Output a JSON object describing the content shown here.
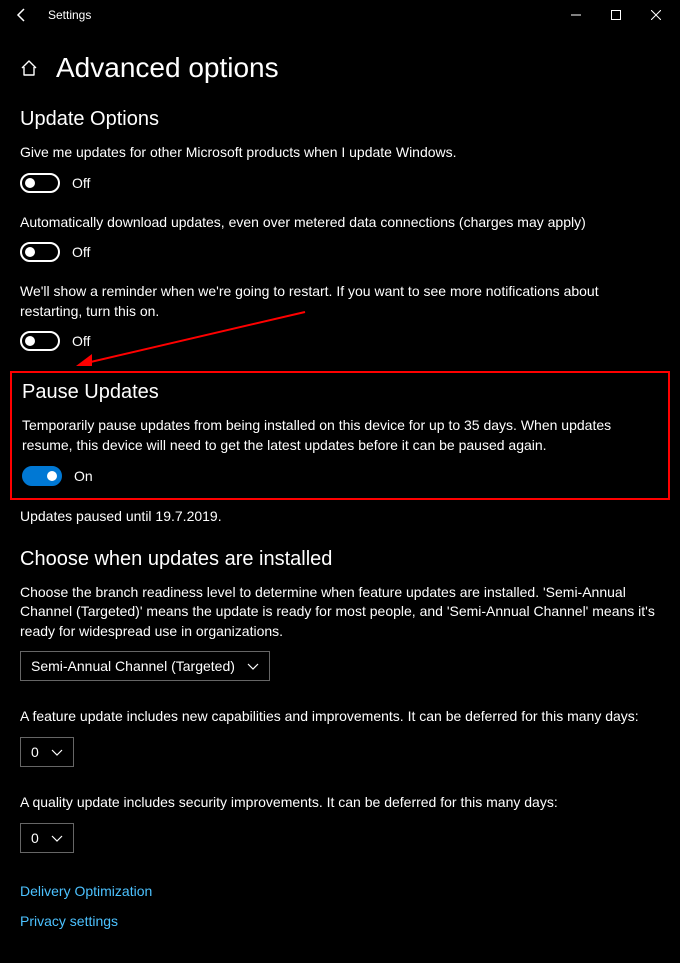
{
  "titlebar": {
    "app_title": "Settings"
  },
  "header": {
    "page_title": "Advanced options"
  },
  "update_options": {
    "heading": "Update Options",
    "item1": {
      "desc": "Give me updates for other Microsoft products when I update Windows.",
      "state": "Off"
    },
    "item2": {
      "desc": "Automatically download updates, even over metered data connections (charges may apply)",
      "state": "Off"
    },
    "item3": {
      "desc": "We'll show a reminder when we're going to restart. If you want to see more notifications about restarting, turn this on.",
      "state": "Off"
    }
  },
  "pause_updates": {
    "heading": "Pause Updates",
    "desc": "Temporarily pause updates from being installed on this device for up to 35 days. When updates resume, this device will need to get the latest updates before it can be paused again.",
    "state": "On",
    "status": "Updates paused until 19.7.2019."
  },
  "choose_when": {
    "heading": "Choose when updates are installed",
    "desc": "Choose the branch readiness level to determine when feature updates are installed. 'Semi-Annual Channel (Targeted)' means the update is ready for most people, and 'Semi-Annual Channel' means it's ready for widespread use in organizations.",
    "branch_value": "Semi-Annual Channel (Targeted)",
    "feature_desc": "A feature update includes new capabilities and improvements. It can be deferred for this many days:",
    "feature_days": "0",
    "quality_desc": "A quality update includes security improvements. It can be deferred for this many days:",
    "quality_days": "0"
  },
  "links": {
    "delivery": "Delivery Optimization",
    "privacy": "Privacy settings"
  }
}
